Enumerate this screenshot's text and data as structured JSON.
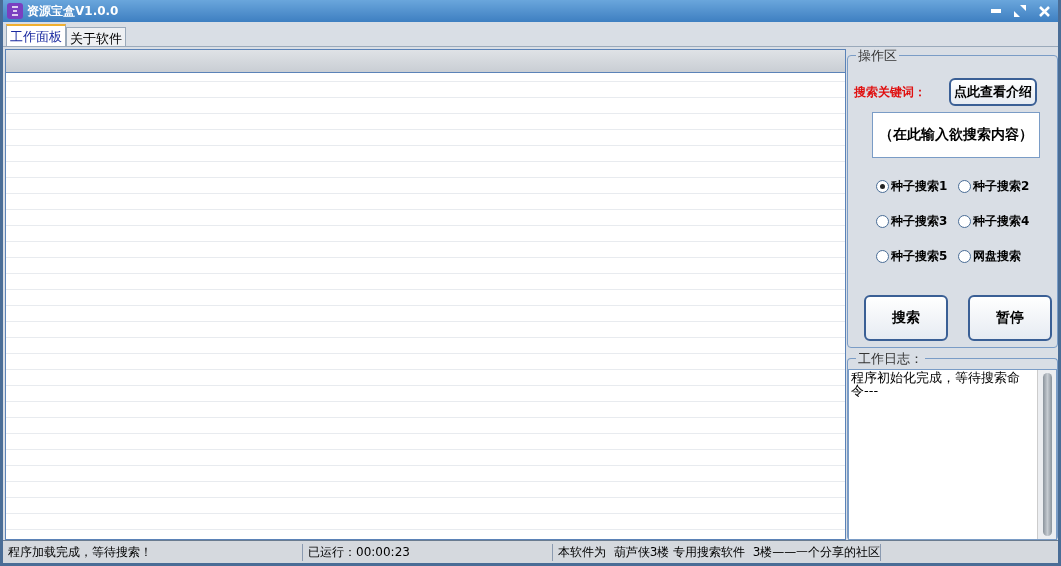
{
  "window": {
    "title": "资源宝盒V1.0.0"
  },
  "tabs": [
    {
      "label": "工作面板",
      "selected": true
    },
    {
      "label": "关于软件",
      "selected": false
    }
  ],
  "operation_panel": {
    "title": "操作区",
    "keyword_label": "搜索关键词：",
    "intro_button": "点此查看介绍",
    "search_field": {
      "value": "（在此输入欲搜索内容）"
    },
    "search_modes": [
      {
        "label": "种子搜索1",
        "selected": true
      },
      {
        "label": "种子搜索2",
        "selected": false
      },
      {
        "label": "种子搜索3",
        "selected": false
      },
      {
        "label": "种子搜索4",
        "selected": false
      },
      {
        "label": "种子搜索5",
        "selected": false
      },
      {
        "label": "网盘搜索",
        "selected": false
      }
    ],
    "buttons": [
      "搜索",
      "暂停"
    ]
  },
  "log_panel": {
    "title": "工作日志：",
    "text": "程序初始化完成，等待搜索命令---"
  },
  "status_bar": [
    "程序加载完成，等待搜索！",
    "已运行：00:00:23",
    "本软件为  葫芦侠3楼 专用搜索软件  3楼——一个分享的社区"
  ]
}
